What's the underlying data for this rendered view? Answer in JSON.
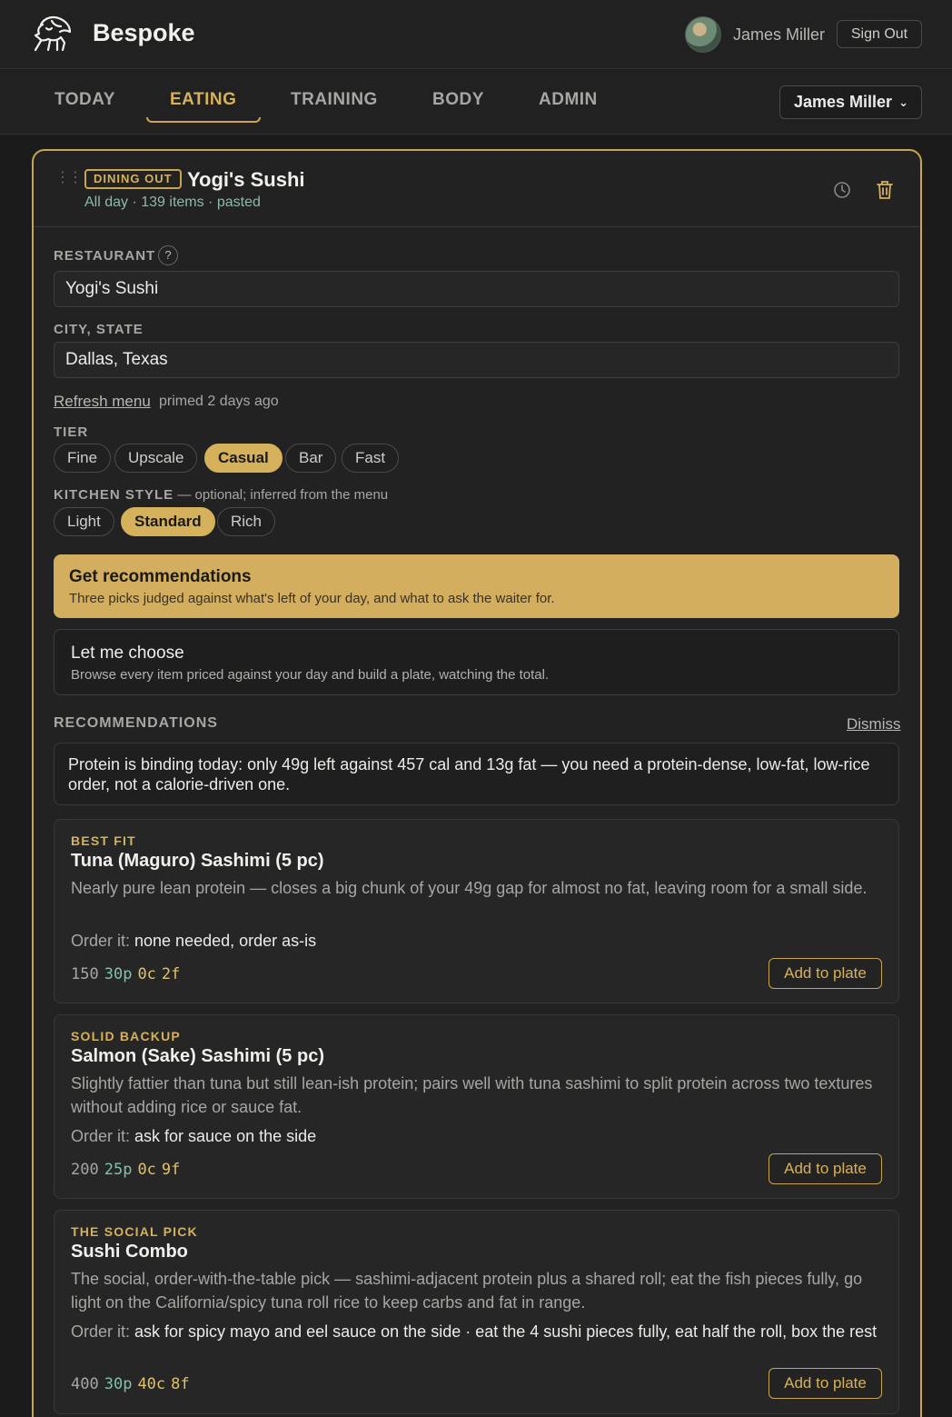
{
  "header": {
    "brand": "Bespoke",
    "user_name": "James Miller",
    "sign_out_label": "Sign Out"
  },
  "nav": {
    "tabs": [
      {
        "label": "TODAY",
        "active": false
      },
      {
        "label": "EATING",
        "active": true
      },
      {
        "label": "TRAINING",
        "active": false
      },
      {
        "label": "BODY",
        "active": false
      },
      {
        "label": "ADMIN",
        "active": false
      }
    ],
    "user_select": "James Miller"
  },
  "card": {
    "badge": "DINING OUT",
    "title": "Yogi's Sushi",
    "meta": "All day · 139 items · pasted"
  },
  "form": {
    "restaurant_label": "RESTAURANT",
    "restaurant_help": "?",
    "restaurant_value": "Yogi's Sushi",
    "city_label": "CITY, STATE",
    "city_value": "Dallas, Texas",
    "refresh_label": "Refresh menu",
    "primed_text": "primed 2 days ago",
    "tier_label": "TIER",
    "tiers": [
      {
        "label": "Fine",
        "selected": false
      },
      {
        "label": "Upscale",
        "selected": false
      },
      {
        "label": "Casual",
        "selected": true
      },
      {
        "label": "Bar",
        "selected": false
      },
      {
        "label": "Fast",
        "selected": false
      }
    ],
    "kitchen_label": "KITCHEN STYLE",
    "kitchen_hint": " — optional; inferred from the menu",
    "kitchen_styles": [
      {
        "label": "Light",
        "selected": false
      },
      {
        "label": "Standard",
        "selected": true
      },
      {
        "label": "Rich",
        "selected": false
      }
    ]
  },
  "actions": {
    "recommend_title": "Get recommendations",
    "recommend_desc": "Three picks judged against what's left of your day, and what to ask the waiter for.",
    "choose_title": "Let me choose",
    "choose_desc": "Browse every item priced against your day and build a plate, watching the total."
  },
  "recommendations": {
    "heading": "RECOMMENDATIONS",
    "dismiss_label": "Dismiss",
    "summary": "Protein is binding today: only 49g left against 457 cal and 13g fat — you need a protein-dense, low-fat, low-rice order, not a calorie-driven one.",
    "order_prefix": "Order it: ",
    "add_label": "Add to plate",
    "items": [
      {
        "kicker": "BEST FIT",
        "name": "Tuna (Maguro) Sashimi (5 pc)",
        "desc": "Nearly pure lean protein — closes a big chunk of your 49g gap for almost no fat, leaving room for a small side.",
        "order": "none needed, order as-is",
        "cal": "150",
        "protein": "30p",
        "carbs": "0c",
        "fat": "2f"
      },
      {
        "kicker": "SOLID BACKUP",
        "name": "Salmon (Sake) Sashimi (5 pc)",
        "desc": "Slightly fattier than tuna but still lean-ish protein; pairs well with tuna sashimi to split protein across two textures without adding rice or sauce fat.",
        "order": "ask for sauce on the side",
        "cal": "200",
        "protein": "25p",
        "carbs": "0c",
        "fat": "9f"
      },
      {
        "kicker": "THE SOCIAL PICK",
        "name": "Sushi Combo",
        "desc": "The social, order-with-the-table pick — sashimi-adjacent protein plus a shared roll; eat the fish pieces fully, go light on the California/spicy tuna roll rice to keep carbs and fat in range.",
        "order": "ask for spicy mayo and eel sauce on the side · eat the 4 sushi pieces fully, eat half the roll, box the rest",
        "cal": "400",
        "protein": "30p",
        "carbs": "40c",
        "fat": "8f"
      }
    ]
  },
  "colors": {
    "accent": "#d6b15c",
    "background": "#1b1b1b",
    "protein": "#7fc2a8"
  }
}
